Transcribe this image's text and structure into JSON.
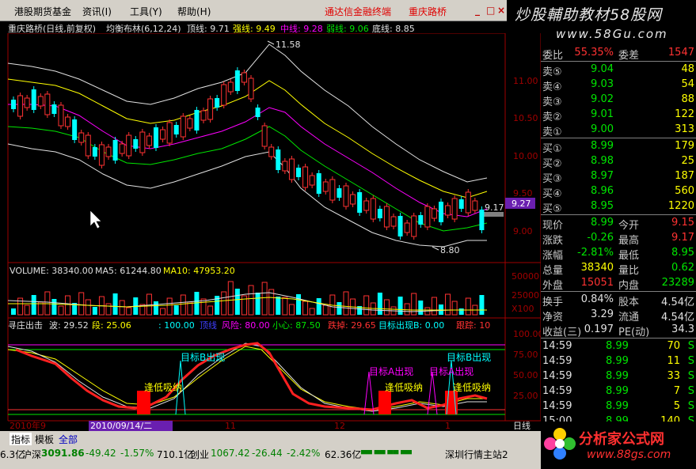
{
  "menu": {
    "items": [
      "港股期货基金",
      "资讯(I)",
      "工具(Y)",
      "帮助(H)"
    ],
    "accent_items": [
      "通达信金融终端",
      "重庆路桥"
    ],
    "window_buttons": [
      "_",
      "□",
      "×"
    ]
  },
  "logo": {
    "title": "炒股輔助教材58股网",
    "url": "www.58Gu.com"
  },
  "header": {
    "title": "重庆路桥(日线,前复权)",
    "indicator": "均衡布林(6,12,24)",
    "top": "顶线: 9.71",
    "strong": "强线: 9.49",
    "mid": "中线: 9.28",
    "weak": "弱线: 9.06",
    "bottom": "底线: 8.85"
  },
  "price_chart": {
    "y_ticks": [
      "11.00",
      "10.50",
      "10.00",
      "9.50",
      "9.00"
    ],
    "high_label": "11.58",
    "low_label": "8.80",
    "last_label": "9.17",
    "price_tag": "9.27"
  },
  "volume": {
    "header_volume": "VOLUME: 38340.00",
    "header_ma5": "MA5: 61244.80",
    "header_ma10": "MA10: 47953.20",
    "y_ticks": [
      "50000",
      "25000",
      "X100"
    ]
  },
  "indicator": {
    "name": "寻庄出击",
    "wave": "波: 29.52",
    "segment": "段: 25.06",
    "v1": ": 100.00",
    "v2": "顶线",
    "risk": "风险: 80.00",
    "care": "小心: 87.50",
    "break": "跌掉: 29.65",
    "target": "目标出现B: 0.00",
    "follow": "跟踪: 10",
    "y_ticks": [
      "100.00",
      "75.00",
      "50.00",
      "25.00"
    ],
    "annotations": [
      "逢低吸纳",
      "目标B出现",
      "目标A出现",
      "逢低吸纳",
      "目标A出现",
      "目标B出现",
      "逢低吸纳"
    ]
  },
  "x_axis": {
    "labels": [
      "2010年9",
      "2010/09/14/二",
      "11",
      "12",
      "1",
      "日线"
    ]
  },
  "quote": {
    "ratio_label": "委比",
    "ratio": "55.35%",
    "diff_label": "委差",
    "diff": "1547",
    "sells": [
      {
        "label": "卖⑤",
        "price": "9.04",
        "vol": "48"
      },
      {
        "label": "卖④",
        "price": "9.03",
        "vol": "54"
      },
      {
        "label": "卖③",
        "price": "9.02",
        "vol": "88"
      },
      {
        "label": "卖②",
        "price": "9.01",
        "vol": "122"
      },
      {
        "label": "卖①",
        "price": "9.00",
        "vol": "313"
      }
    ],
    "buys": [
      {
        "label": "买①",
        "price": "8.99",
        "vol": "179"
      },
      {
        "label": "买②",
        "price": "8.98",
        "vol": "25"
      },
      {
        "label": "买③",
        "price": "8.97",
        "vol": "187"
      },
      {
        "label": "买④",
        "price": "8.96",
        "vol": "560"
      },
      {
        "label": "买⑤",
        "price": "8.95",
        "vol": "1220"
      }
    ],
    "stats": [
      {
        "l1": "现价",
        "v1": "8.99",
        "c1": "green",
        "l2": "今开",
        "v2": "9.15",
        "c2": "red"
      },
      {
        "l1": "涨跌",
        "v1": "-0.26",
        "c1": "green",
        "l2": "最高",
        "v2": "9.17",
        "c2": "red"
      },
      {
        "l1": "涨幅",
        "v1": "-2.81%",
        "c1": "green",
        "l2": "最低",
        "v2": "8.95",
        "c2": "green"
      },
      {
        "l1": "总量",
        "v1": "38340",
        "c1": "yellow",
        "l2": "量比",
        "v2": "0.62",
        "c2": "green"
      },
      {
        "l1": "外盘",
        "v1": "15051",
        "c1": "red",
        "l2": "内盘",
        "v2": "23289",
        "c2": "green"
      }
    ],
    "stats2": [
      {
        "l1": "换手",
        "v1": "0.84%",
        "l2": "股本",
        "v2": "4.54亿"
      },
      {
        "l1": "净资",
        "v1": "3.29",
        "l2": "流通",
        "v2": "4.54亿"
      },
      {
        "l1": "收益(三)",
        "v1": "0.197",
        "l2": "PE(动)",
        "v2": "34.3"
      }
    ],
    "ticks": [
      {
        "time": "14:59",
        "price": "8.99",
        "vol": "70",
        "flag": "S"
      },
      {
        "time": "14:59",
        "price": "8.99",
        "vol": "11",
        "flag": "S"
      },
      {
        "time": "14:59",
        "price": "8.99",
        "vol": "33",
        "flag": "S"
      },
      {
        "time": "14:59",
        "price": "8.99",
        "vol": "7",
        "flag": "S"
      },
      {
        "time": "14:59",
        "price": "8.99",
        "vol": "5",
        "flag": "S"
      },
      {
        "time": "15:00",
        "price": "8.99",
        "vol": "140",
        "flag": "S"
      }
    ]
  },
  "tabs": [
    "指标",
    "模板",
    "全部"
  ],
  "ticker": {
    "sh": "6.3亿",
    "sz_label": "沪深",
    "sz": "3091.86",
    "sz_chg": "-49.42",
    "sz_pct": "-1.57%",
    "sz_amt": "710.1亿",
    "cy_label": "创业",
    "cy": "1067.42",
    "cy_chg": "-26.44",
    "cy_pct": "-2.42%",
    "cy_amt": "62.36亿",
    "station": "深圳行情主站2"
  },
  "gs_logo": {
    "name": "分析家公式网",
    "url": "www.88gs.com"
  },
  "colors": {
    "up": "#ff3232",
    "down": "#00ffff",
    "green": "#00e600",
    "yellow": "#ffff00",
    "magenta": "#ff00ff"
  }
}
